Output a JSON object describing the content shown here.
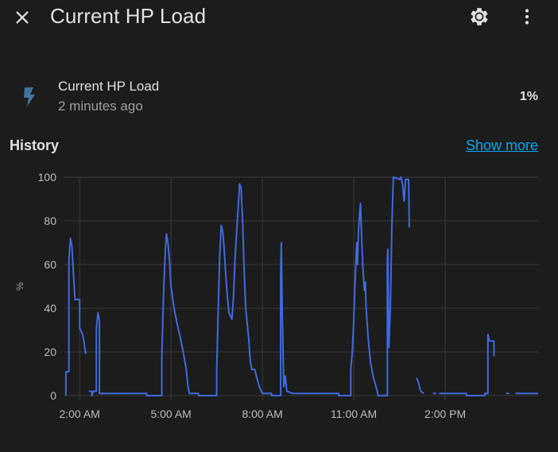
{
  "header": {
    "title": "Current HP Load"
  },
  "entity": {
    "name": "Current HP Load",
    "last_changed": "2 minutes ago",
    "state": "1%"
  },
  "history": {
    "title": "History",
    "show_more_label": "Show more"
  },
  "colors": {
    "background": "#1c1c1c",
    "line": "#3f6ae0",
    "link": "#03a9f4",
    "icon": "#44739e"
  },
  "chart_data": {
    "type": "line",
    "ylabel": "%",
    "ylim": [
      0,
      100
    ],
    "yticks": [
      0,
      20,
      40,
      60,
      80,
      100
    ],
    "xlim": [
      1.5,
      17.05
    ],
    "xticks": [
      {
        "value": 2,
        "label": "2:00 AM"
      },
      {
        "value": 5,
        "label": "5:00 AM"
      },
      {
        "value": 8,
        "label": "8:00 AM"
      },
      {
        "value": 11,
        "label": "11:00 AM"
      },
      {
        "value": 14,
        "label": "2:00 PM"
      }
    ],
    "grid": true,
    "series": [
      {
        "segments": [
          [
            [
              1.55,
              0
            ],
            [
              1.55,
              11
            ],
            [
              1.65,
              11
            ],
            [
              1.65,
              62
            ],
            [
              1.7,
              72
            ],
            [
              1.75,
              68
            ],
            [
              1.8,
              55
            ],
            [
              1.85,
              44
            ],
            [
              2.0,
              44
            ],
            [
              2.0,
              31
            ],
            [
              2.1,
              28
            ],
            [
              2.15,
              24
            ],
            [
              2.2,
              19
            ]
          ],
          [
            [
              2.3,
              2
            ],
            [
              2.4,
              2
            ],
            [
              2.4,
              0
            ],
            [
              2.45,
              2
            ],
            [
              2.55,
              2
            ],
            [
              2.55,
              30
            ],
            [
              2.6,
              38
            ],
            [
              2.65,
              34
            ],
            [
              2.65,
              1
            ],
            [
              3.0,
              1
            ],
            [
              4.0,
              1
            ],
            [
              4.2,
              1
            ],
            [
              4.2,
              0
            ],
            [
              4.5,
              0
            ],
            [
              4.7,
              0
            ],
            [
              4.7,
              18
            ],
            [
              4.75,
              45
            ],
            [
              4.8,
              63
            ],
            [
              4.85,
              74
            ],
            [
              4.9,
              70
            ],
            [
              4.95,
              62
            ],
            [
              5.0,
              50
            ],
            [
              5.1,
              40
            ],
            [
              5.2,
              33
            ],
            [
              5.3,
              27
            ],
            [
              5.4,
              20
            ],
            [
              5.5,
              12
            ],
            [
              5.55,
              5
            ],
            [
              5.6,
              1
            ],
            [
              5.7,
              1
            ],
            [
              5.9,
              1
            ],
            [
              5.9,
              0
            ],
            [
              6.2,
              0
            ],
            [
              6.5,
              0
            ],
            [
              6.5,
              12
            ],
            [
              6.55,
              40
            ],
            [
              6.6,
              65
            ],
            [
              6.65,
              78
            ],
            [
              6.7,
              75
            ],
            [
              6.75,
              66
            ],
            [
              6.8,
              55
            ],
            [
              6.85,
              45
            ],
            [
              6.9,
              38
            ],
            [
              7.0,
              35
            ],
            [
              7.05,
              45
            ],
            [
              7.1,
              62
            ],
            [
              7.2,
              85
            ],
            [
              7.25,
              97
            ],
            [
              7.3,
              95
            ],
            [
              7.35,
              80
            ],
            [
              7.4,
              58
            ],
            [
              7.45,
              40
            ],
            [
              7.55,
              26
            ],
            [
              7.6,
              16
            ],
            [
              7.65,
              12
            ],
            [
              7.75,
              12
            ],
            [
              7.8,
              9
            ],
            [
              7.9,
              4
            ],
            [
              8.0,
              1
            ],
            [
              8.1,
              1
            ],
            [
              8.3,
              1
            ],
            [
              8.3,
              0
            ],
            [
              8.6,
              0
            ],
            [
              8.6,
              55
            ],
            [
              8.62,
              70
            ],
            [
              8.65,
              40
            ],
            [
              8.7,
              4
            ],
            [
              8.75,
              9
            ],
            [
              8.8,
              2
            ],
            [
              9.0,
              1
            ],
            [
              10.0,
              1
            ],
            [
              10.5,
              1
            ],
            [
              10.5,
              0
            ],
            [
              10.9,
              0
            ],
            [
              10.9,
              12
            ],
            [
              10.95,
              20
            ],
            [
              11.0,
              35
            ],
            [
              11.05,
              55
            ],
            [
              11.1,
              70
            ],
            [
              11.12,
              60
            ],
            [
              11.15,
              75
            ],
            [
              11.2,
              85
            ],
            [
              11.22,
              88
            ],
            [
              11.25,
              75
            ],
            [
              11.3,
              58
            ],
            [
              11.35,
              48
            ],
            [
              11.38,
              52
            ],
            [
              11.4,
              42
            ],
            [
              11.45,
              30
            ],
            [
              11.5,
              22
            ],
            [
              11.55,
              15
            ],
            [
              11.65,
              8
            ],
            [
              11.75,
              3
            ],
            [
              11.8,
              0
            ],
            [
              12.0,
              0
            ],
            [
              12.1,
              0
            ],
            [
              12.1,
              62
            ],
            [
              12.12,
              67
            ],
            [
              12.15,
              22
            ],
            [
              12.2,
              40
            ],
            [
              12.25,
              78
            ],
            [
              12.3,
              100
            ],
            [
              12.5,
              99
            ],
            [
              12.55,
              100
            ],
            [
              12.6,
              97
            ],
            [
              12.65,
              89
            ],
            [
              12.7,
              99
            ],
            [
              12.8,
              99
            ],
            [
              12.82,
              77
            ]
          ],
          [
            [
              13.05,
              8
            ],
            [
              13.1,
              7
            ],
            [
              13.2,
              2
            ],
            [
              13.3,
              1
            ]
          ],
          [
            [
              13.6,
              1
            ],
            [
              13.7,
              1
            ]
          ],
          [
            [
              13.8,
              1
            ],
            [
              14.5,
              1
            ],
            [
              14.7,
              1
            ],
            [
              14.7,
              0
            ],
            [
              15.3,
              0
            ],
            [
              15.3,
              1
            ],
            [
              15.4,
              1
            ],
            [
              15.4,
              28
            ],
            [
              15.45,
              25
            ],
            [
              15.6,
              25
            ],
            [
              15.6,
              18
            ]
          ],
          [
            [
              16.0,
              1
            ],
            [
              16.1,
              1
            ]
          ],
          [
            [
              16.3,
              1
            ],
            [
              17.05,
              1
            ]
          ]
        ]
      }
    ]
  }
}
